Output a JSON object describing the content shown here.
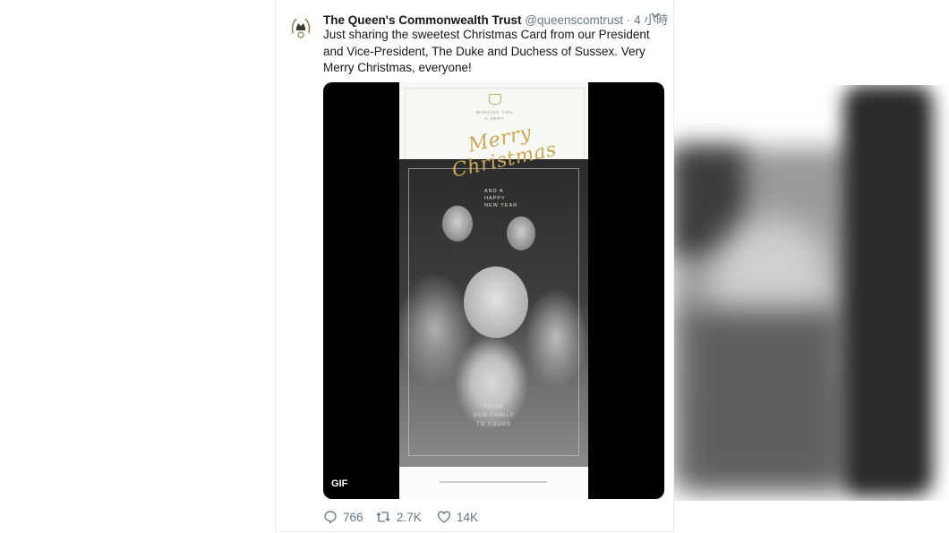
{
  "tweet": {
    "display_name": "The Queen's Commonwealth Trust",
    "handle": "@queenscomtrust",
    "separator": "·",
    "time": "4 小時",
    "text": "Just sharing the sweetest Christmas Card from our President and Vice-President, The Duke and Duchess of Sussex. Very Merry Christmas, everyone!"
  },
  "media": {
    "gif_badge": "GIF",
    "card": {
      "wishing": "WISHING YOU",
      "a_very": "A VERY",
      "merry": "Merry",
      "christmas": "Christmas",
      "and_a": "AND A",
      "happy": "HAPPY",
      "new_year": "NEW YEAR",
      "from": "FROM",
      "our_family": "OUR FAMILY",
      "to_yours": "TO YOURS"
    }
  },
  "actions": {
    "replies": "766",
    "retweets": "2.7K",
    "likes": "14K"
  },
  "icons": {
    "avatar": "crest-icon",
    "menu": "chevron-down-icon",
    "reply": "reply-icon",
    "retweet": "retweet-icon",
    "like": "heart-icon"
  },
  "colors": {
    "text": "#14171a",
    "secondary": "#657786",
    "card_gold": "#c9a95a"
  }
}
